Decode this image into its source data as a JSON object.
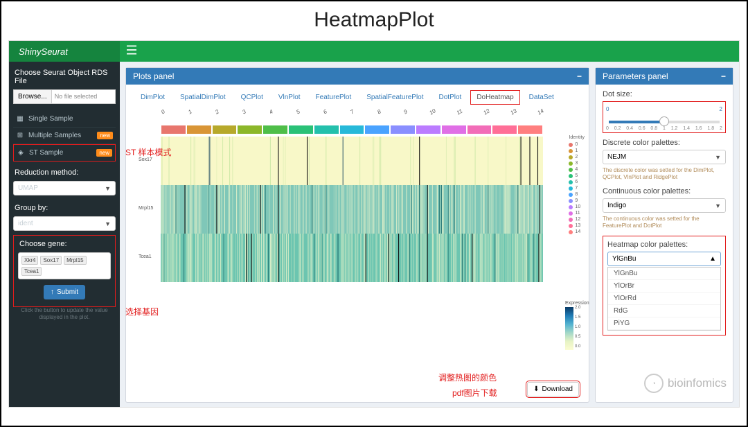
{
  "page_title": "HeatmapPlot",
  "brand": "ShinySeurat",
  "sidebar": {
    "file_label": "Choose Seurat Object RDS File",
    "browse": "Browse...",
    "nofile": "No file selected",
    "items": [
      {
        "icon": "▦",
        "label": "Single Sample",
        "badge": ""
      },
      {
        "icon": "⊞",
        "label": "Multiple Samples",
        "badge": "new"
      },
      {
        "icon": "◈",
        "label": "ST Sample",
        "badge": "new"
      }
    ],
    "reduction_label": "Reduction method:",
    "reduction_value": "UMAP",
    "group_label": "Group by:",
    "group_value": "ident",
    "gene_label": "Choose gene:",
    "genes": [
      "Xkr4",
      "Sox17",
      "Mrpl15",
      "Tcea1"
    ],
    "submit": "Submit",
    "hint": "Click the button to update the value displayed in the plot."
  },
  "plots": {
    "header": "Plots panel",
    "tabs": [
      "DimPlot",
      "SpatialDimPlot",
      "QCPlot",
      "VlnPlot",
      "FeaturePlot",
      "SpatialFeaturePlot",
      "DotPlot",
      "DoHeatmap",
      "DataSet"
    ],
    "active_tab": "DoHeatmap",
    "download": "Download",
    "cluster_labels": [
      "0",
      "1",
      "2",
      "3",
      "4",
      "5",
      "6",
      "7",
      "8",
      "9",
      "10",
      "11",
      "12",
      "13",
      "14"
    ],
    "cluster_colors": [
      "#e8766d",
      "#d99536",
      "#b7a92b",
      "#8cb72a",
      "#4fbe49",
      "#2ac177",
      "#24c0ac",
      "#27b9d9",
      "#4aa3ff",
      "#8a8fff",
      "#bb7cff",
      "#e06fe6",
      "#f26db8",
      "#ff6f97",
      "#ff7f7f"
    ],
    "row_labels": [
      "Sox17",
      "Mrpl15",
      "Tcea1"
    ],
    "legend_title": "Identity",
    "legend_items": [
      "0",
      "1",
      "2",
      "3",
      "4",
      "5",
      "6",
      "7",
      "8",
      "9",
      "10",
      "11",
      "12",
      "13",
      "14"
    ],
    "expr_title": "Expression",
    "expr_ticks": [
      "2.0",
      "1.5",
      "1.0",
      "0.5",
      "0.0"
    ]
  },
  "params": {
    "header": "Parameters panel",
    "dot_label": "Dot size:",
    "dot_min": "0",
    "dot_max": "2",
    "dot_ticks": [
      "0",
      "0.2",
      "0.4",
      "0.6",
      "0.8",
      "1",
      "1.2",
      "1.4",
      "1.6",
      "1.8",
      "2"
    ],
    "dot_value": 1,
    "discrete_label": "Discrete color palettes:",
    "discrete_value": "NEJM",
    "discrete_hint": "The discrete color was setted for the DimPlot, QCPlot, VlnPlot and RidgePlot",
    "cont_label": "Continuous color palettes:",
    "cont_value": "Indigo",
    "cont_hint": "The continuous color was setted for the FeaturePlot and DotPlot",
    "heatmap_label": "Heatmap color palettes:",
    "heatmap_value": "YlGnBu",
    "heatmap_options": [
      "YlGnBu",
      "YlOrBr",
      "YlOrRd",
      "RdG",
      "PiYG"
    ]
  },
  "annotations": {
    "st_mode": "ST 样本模式",
    "select_gene": "选择基因",
    "adjust_color": "调整热图的颜色",
    "pdf_dl": "pdf图片下载"
  },
  "watermark": "bioinfomics"
}
